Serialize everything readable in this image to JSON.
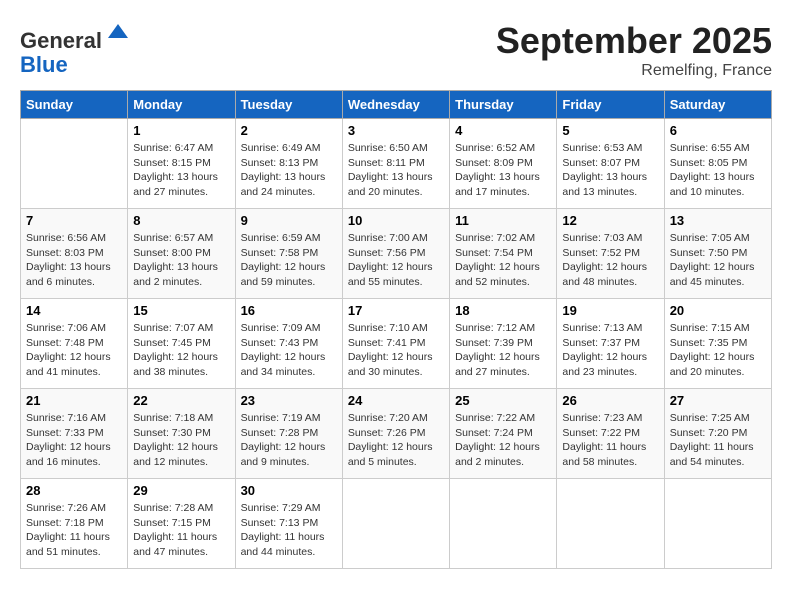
{
  "header": {
    "logo_general": "General",
    "logo_blue": "Blue",
    "month": "September 2025",
    "location": "Remelfing, France"
  },
  "days_of_week": [
    "Sunday",
    "Monday",
    "Tuesday",
    "Wednesday",
    "Thursday",
    "Friday",
    "Saturday"
  ],
  "weeks": [
    [
      {
        "day": "",
        "info": ""
      },
      {
        "day": "1",
        "info": "Sunrise: 6:47 AM\nSunset: 8:15 PM\nDaylight: 13 hours\nand 27 minutes."
      },
      {
        "day": "2",
        "info": "Sunrise: 6:49 AM\nSunset: 8:13 PM\nDaylight: 13 hours\nand 24 minutes."
      },
      {
        "day": "3",
        "info": "Sunrise: 6:50 AM\nSunset: 8:11 PM\nDaylight: 13 hours\nand 20 minutes."
      },
      {
        "day": "4",
        "info": "Sunrise: 6:52 AM\nSunset: 8:09 PM\nDaylight: 13 hours\nand 17 minutes."
      },
      {
        "day": "5",
        "info": "Sunrise: 6:53 AM\nSunset: 8:07 PM\nDaylight: 13 hours\nand 13 minutes."
      },
      {
        "day": "6",
        "info": "Sunrise: 6:55 AM\nSunset: 8:05 PM\nDaylight: 13 hours\nand 10 minutes."
      }
    ],
    [
      {
        "day": "7",
        "info": "Sunrise: 6:56 AM\nSunset: 8:03 PM\nDaylight: 13 hours\nand 6 minutes."
      },
      {
        "day": "8",
        "info": "Sunrise: 6:57 AM\nSunset: 8:00 PM\nDaylight: 13 hours\nand 2 minutes."
      },
      {
        "day": "9",
        "info": "Sunrise: 6:59 AM\nSunset: 7:58 PM\nDaylight: 12 hours\nand 59 minutes."
      },
      {
        "day": "10",
        "info": "Sunrise: 7:00 AM\nSunset: 7:56 PM\nDaylight: 12 hours\nand 55 minutes."
      },
      {
        "day": "11",
        "info": "Sunrise: 7:02 AM\nSunset: 7:54 PM\nDaylight: 12 hours\nand 52 minutes."
      },
      {
        "day": "12",
        "info": "Sunrise: 7:03 AM\nSunset: 7:52 PM\nDaylight: 12 hours\nand 48 minutes."
      },
      {
        "day": "13",
        "info": "Sunrise: 7:05 AM\nSunset: 7:50 PM\nDaylight: 12 hours\nand 45 minutes."
      }
    ],
    [
      {
        "day": "14",
        "info": "Sunrise: 7:06 AM\nSunset: 7:48 PM\nDaylight: 12 hours\nand 41 minutes."
      },
      {
        "day": "15",
        "info": "Sunrise: 7:07 AM\nSunset: 7:45 PM\nDaylight: 12 hours\nand 38 minutes."
      },
      {
        "day": "16",
        "info": "Sunrise: 7:09 AM\nSunset: 7:43 PM\nDaylight: 12 hours\nand 34 minutes."
      },
      {
        "day": "17",
        "info": "Sunrise: 7:10 AM\nSunset: 7:41 PM\nDaylight: 12 hours\nand 30 minutes."
      },
      {
        "day": "18",
        "info": "Sunrise: 7:12 AM\nSunset: 7:39 PM\nDaylight: 12 hours\nand 27 minutes."
      },
      {
        "day": "19",
        "info": "Sunrise: 7:13 AM\nSunset: 7:37 PM\nDaylight: 12 hours\nand 23 minutes."
      },
      {
        "day": "20",
        "info": "Sunrise: 7:15 AM\nSunset: 7:35 PM\nDaylight: 12 hours\nand 20 minutes."
      }
    ],
    [
      {
        "day": "21",
        "info": "Sunrise: 7:16 AM\nSunset: 7:33 PM\nDaylight: 12 hours\nand 16 minutes."
      },
      {
        "day": "22",
        "info": "Sunrise: 7:18 AM\nSunset: 7:30 PM\nDaylight: 12 hours\nand 12 minutes."
      },
      {
        "day": "23",
        "info": "Sunrise: 7:19 AM\nSunset: 7:28 PM\nDaylight: 12 hours\nand 9 minutes."
      },
      {
        "day": "24",
        "info": "Sunrise: 7:20 AM\nSunset: 7:26 PM\nDaylight: 12 hours\nand 5 minutes."
      },
      {
        "day": "25",
        "info": "Sunrise: 7:22 AM\nSunset: 7:24 PM\nDaylight: 12 hours\nand 2 minutes."
      },
      {
        "day": "26",
        "info": "Sunrise: 7:23 AM\nSunset: 7:22 PM\nDaylight: 11 hours\nand 58 minutes."
      },
      {
        "day": "27",
        "info": "Sunrise: 7:25 AM\nSunset: 7:20 PM\nDaylight: 11 hours\nand 54 minutes."
      }
    ],
    [
      {
        "day": "28",
        "info": "Sunrise: 7:26 AM\nSunset: 7:18 PM\nDaylight: 11 hours\nand 51 minutes."
      },
      {
        "day": "29",
        "info": "Sunrise: 7:28 AM\nSunset: 7:15 PM\nDaylight: 11 hours\nand 47 minutes."
      },
      {
        "day": "30",
        "info": "Sunrise: 7:29 AM\nSunset: 7:13 PM\nDaylight: 11 hours\nand 44 minutes."
      },
      {
        "day": "",
        "info": ""
      },
      {
        "day": "",
        "info": ""
      },
      {
        "day": "",
        "info": ""
      },
      {
        "day": "",
        "info": ""
      }
    ]
  ]
}
